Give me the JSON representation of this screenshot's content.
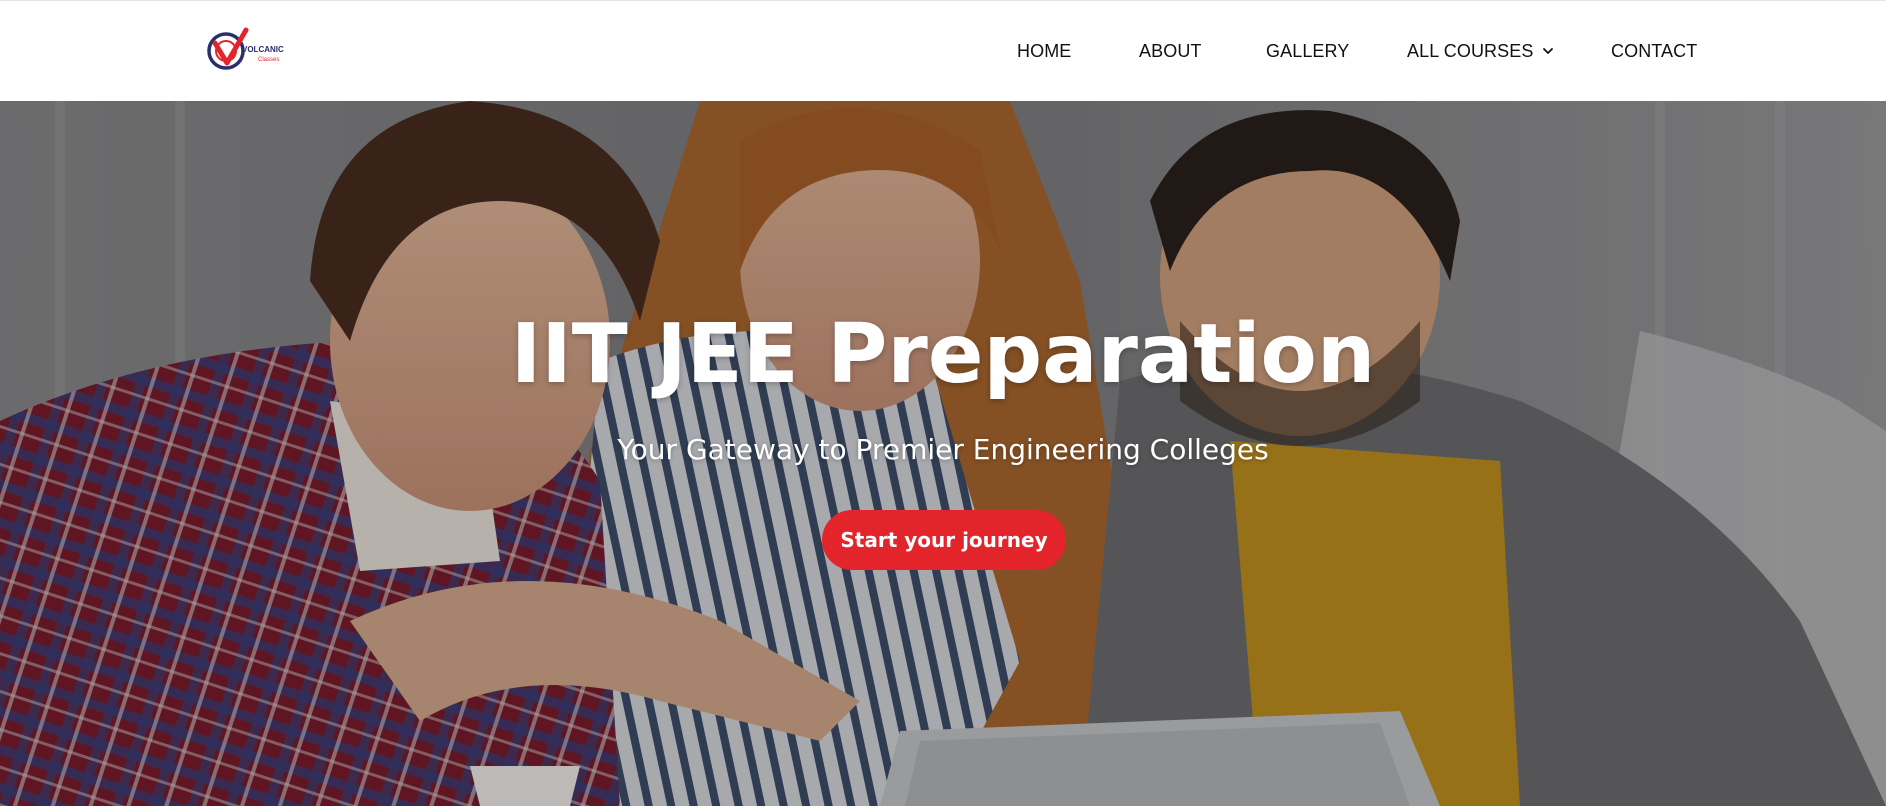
{
  "brand": {
    "logo_text_top": "VOLCANIC",
    "logo_text_bottom": "Classes",
    "accent_color": "#e3242b",
    "logo_navy": "#2a2e6b"
  },
  "nav": {
    "items": [
      {
        "label": "HOME"
      },
      {
        "label": "ABOUT"
      },
      {
        "label": "GALLERY"
      },
      {
        "label": "ALL COURSES",
        "icon": "chevron-down-icon"
      },
      {
        "label": "CONTACT"
      }
    ]
  },
  "hero": {
    "title": "IIT JEE Preparation",
    "subtitle": "Your Gateway to Premier Engineering Colleges",
    "cta_label": "Start your journey",
    "background_image": "three students looking at a laptop"
  }
}
